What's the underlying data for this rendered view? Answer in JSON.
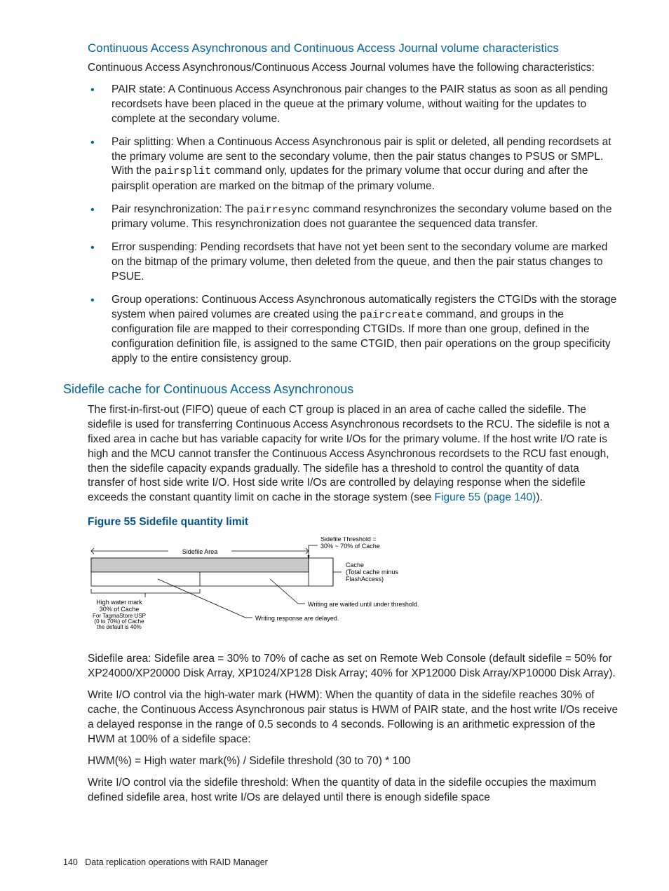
{
  "section1": {
    "heading": "Continuous Access Asynchronous and Continuous Access Journal volume characteristics",
    "intro": "Continuous Access Asynchronous/Continuous Access Journal volumes have the following characteristics:",
    "bullets": {
      "b1a": "PAIR state: A Continuous Access Asynchronous pair changes to the PAIR status as soon as all pending recordsets have been placed in the queue at the primary volume, without waiting for the updates to complete at the secondary volume.",
      "b2a": "Pair splitting: When a Continuous Access Asynchronous pair is split or deleted, all pending recordsets at the primary volume are sent to the secondary volume, then the pair status changes to PSUS or SMPL. With the ",
      "b2cmd": "pairsplit",
      "b2b": " command only, updates for the primary volume that occur during and after the pairsplit operation are marked on the bitmap of the primary volume.",
      "b3a": "Pair resynchronization: The ",
      "b3cmd": "pairresync",
      "b3b": " command resynchronizes the secondary volume based on the primary volume. This resynchronization does not guarantee the sequenced data transfer.",
      "b4": "Error suspending: Pending recordsets that have not yet been sent to the secondary volume are marked on the bitmap of the primary volume, then deleted from the queue, and then the pair status changes to PSUE.",
      "b5a": "Group operations: Continuous Access Asynchronous automatically registers the CTGIDs with the storage system when paired volumes are created using the ",
      "b5cmd": "paircreate",
      "b5b": " command, and groups in the configuration file are mapped to their corresponding CTGIDs. If more than one group, defined in the configuration definition file, is assigned to the same CTGID, then pair operations on the group specificity apply to the entire consistency group."
    }
  },
  "section2": {
    "heading": "Sidefile cache for Continuous Access Asynchronous",
    "p1a": "The first-in-first-out (FIFO) queue of each CT group is placed in an area of cache called the sidefile. The sidefile is used for transferring Continuous Access Asynchronous recordsets to the RCU. The sidefile is not a fixed area in cache but has variable capacity for write I/Os for the primary volume. If the host write I/O rate is high and the MCU cannot transfer the Continuous Access Asynchronous recordsets to the RCU fast enough, then the sidefile capacity expands gradually. The sidefile has a threshold to control the quantity of data transfer of host side write I/O. Host side write I/Os are controlled by delaying response when the sidefile exceeds the constant quantity limit on cache in the storage system (see ",
    "p1link": "Figure 55 (page 140)",
    "p1b": ").",
    "fig_title": "Figure 55 Sidefile quantity limit",
    "fig": {
      "sidefile_area": "Sidefile Area",
      "threshold_label": "Sidefile Threshold =",
      "threshold_vals": "30% ~ 70% of Cache",
      "cache_label": "Cache",
      "cache_sub": "(Total cache minus FlashAccess)",
      "hwm1": "High water mark",
      "hwm2": "30% of Cache",
      "hwm3": "For TagmaStore USP",
      "hwm4": "(0 to 70%) of Cache",
      "hwm5": "the default is 40%",
      "wait": "Writing are waited until under threshold.",
      "delay": "Writing response are delayed."
    },
    "p2": "Sidefile area: Sidefile area = 30% to 70% of cache as set on Remote Web Console (default sidefile = 50% for XP24000/XP20000 Disk Array, XP1024/XP128 Disk Array; 40% for XP12000 Disk Array/XP10000 Disk Array).",
    "p3": "Write I/O control via the high-water mark (HWM): When the quantity of data in the sidefile reaches 30% of cache, the Continuous Access Asynchronous pair status is HWM of PAIR state, and the host write I/Os receive a delayed response in the range of 0.5 seconds to 4 seconds. Following is an arithmetic expression of the HWM at 100% of a sidefile space:",
    "p4": "HWM(%) = High water mark(%) / Sidefile threshold (30 to 70) * 100",
    "p5": "Write I/O control via the sidefile threshold: When the quantity of data in the sidefile occupies the maximum defined sidefile area, host write I/Os are delayed until there is enough sidefile space"
  },
  "footer": {
    "pagenum": "140",
    "chapter": "Data replication operations with RAID Manager"
  }
}
